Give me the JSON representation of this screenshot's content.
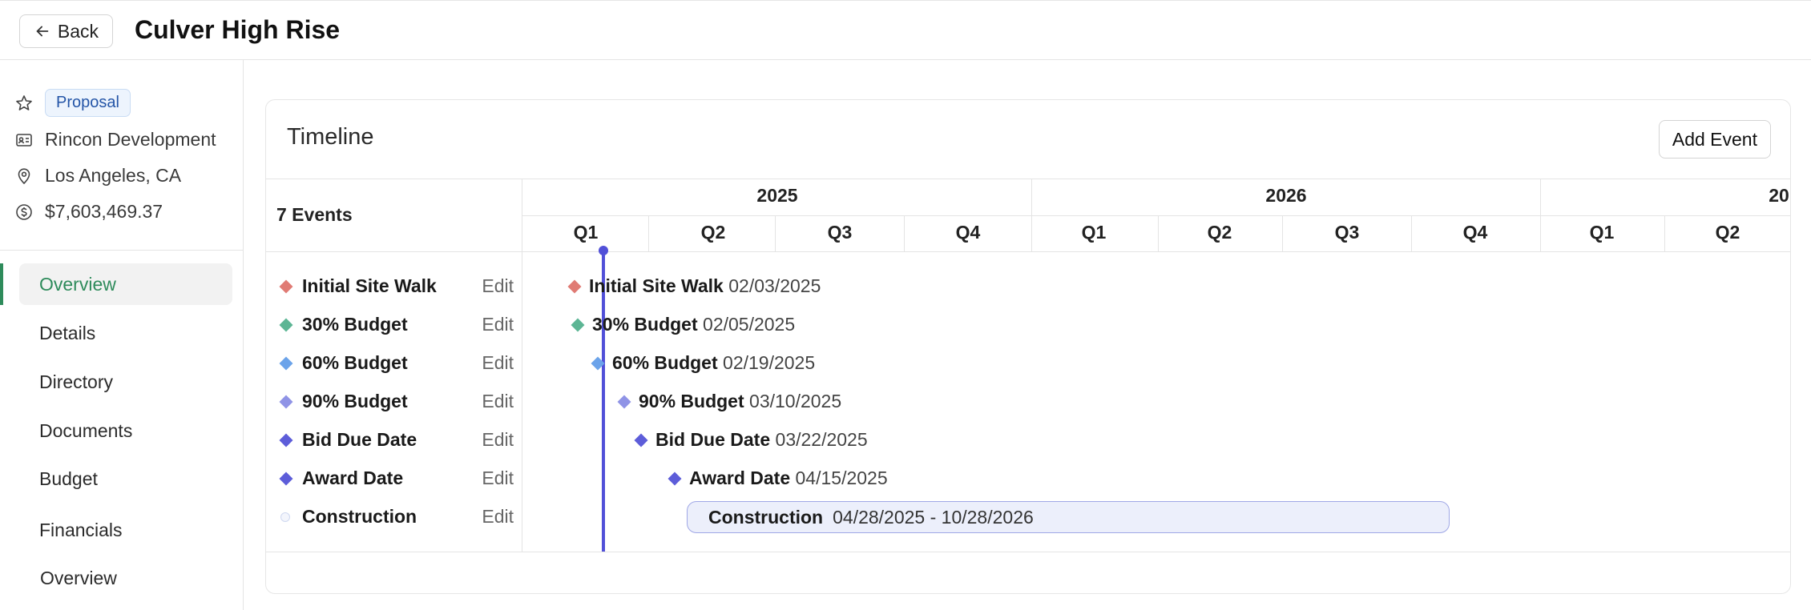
{
  "header": {
    "back_label": "Back",
    "title": "Culver High Rise"
  },
  "project": {
    "status_badge": "Proposal",
    "client": "Rincon Development",
    "location": "Los Angeles, CA",
    "amount": "$7,603,469.37"
  },
  "nav": {
    "items": [
      {
        "label": "Overview",
        "active": true
      },
      {
        "label": "Details"
      },
      {
        "label": "Directory"
      },
      {
        "label": "Documents"
      },
      {
        "label": "Budget"
      },
      {
        "label": "Financials"
      }
    ],
    "sub_items": [
      {
        "label": "Overview"
      }
    ]
  },
  "timeline": {
    "title": "Timeline",
    "add_event_label": "Add Event",
    "events_count": "7 Events",
    "edit_label": "Edit",
    "years": [
      {
        "label": "2025"
      },
      {
        "label": "2026"
      },
      {
        "label": "20"
      }
    ],
    "quarters": [
      {
        "label": "Q1"
      },
      {
        "label": "Q2"
      },
      {
        "label": "Q3"
      },
      {
        "label": "Q4"
      },
      {
        "label": "Q1"
      },
      {
        "label": "Q2"
      },
      {
        "label": "Q3"
      },
      {
        "label": "Q4"
      },
      {
        "label": "Q1"
      },
      {
        "label": "Q2"
      }
    ],
    "events": [
      {
        "name": "Initial Site Walk",
        "date": "02/03/2025",
        "color": "#e07b74",
        "marker": "diamond"
      },
      {
        "name": "30% Budget",
        "date": "02/05/2025",
        "color": "#5cb594",
        "marker": "diamond"
      },
      {
        "name": "60% Budget",
        "date": "02/19/2025",
        "color": "#6ba3ea",
        "marker": "diamond"
      },
      {
        "name": "90% Budget",
        "date": "03/10/2025",
        "color": "#8f93e6",
        "marker": "diamond"
      },
      {
        "name": "Bid Due Date",
        "date": "03/22/2025",
        "color": "#5d5dd9",
        "marker": "diamond"
      },
      {
        "name": "Award Date",
        "date": "04/15/2025",
        "color": "#5d5dd9",
        "marker": "diamond"
      },
      {
        "name": "Construction",
        "date": "04/28/2025 - 10/28/2026",
        "color": "#cfd8f0",
        "marker": "circle"
      }
    ]
  },
  "colors": {
    "accent_green": "#2e8b5b",
    "today_line": "#5150d8",
    "badge_blue": "#2455a7"
  }
}
